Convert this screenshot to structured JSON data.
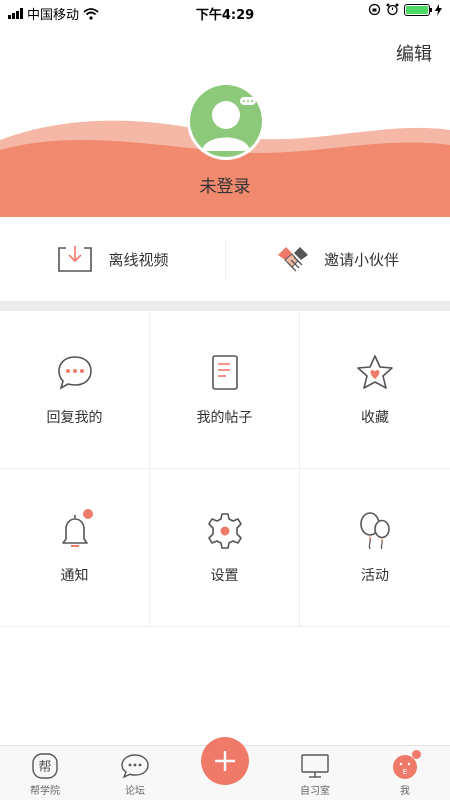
{
  "status_bar": {
    "carrier": "中国移动",
    "time": "下午4:29"
  },
  "header": {
    "edit_label": "编辑",
    "username": "未登录",
    "bg_color": "#f0896e"
  },
  "quick_actions": [
    {
      "label": "离线视频",
      "icon": "download-tray-icon"
    },
    {
      "label": "邀请小伙伴",
      "icon": "handshake-icon"
    }
  ],
  "grid": [
    {
      "label": "回复我的",
      "icon": "chat-bubble-icon"
    },
    {
      "label": "我的帖子",
      "icon": "document-icon"
    },
    {
      "label": "收藏",
      "icon": "star-heart-icon"
    },
    {
      "label": "通知",
      "icon": "bell-icon",
      "badge": true
    },
    {
      "label": "设置",
      "icon": "gear-icon"
    },
    {
      "label": "活动",
      "icon": "balloons-icon"
    }
  ],
  "tab_bar": [
    {
      "label": "帮学院",
      "icon": "bang-icon",
      "glyph": "帮"
    },
    {
      "label": "论坛",
      "icon": "forum-icon"
    },
    {
      "label": "",
      "icon": "plus-icon"
    },
    {
      "label": "自习室",
      "icon": "monitor-icon"
    },
    {
      "label": "我",
      "icon": "profile-pig-icon",
      "active": true
    }
  ],
  "colors": {
    "accent": "#ef7a6a",
    "wave_light": "#f5b8a6",
    "avatar_green": "#8cc97a"
  }
}
